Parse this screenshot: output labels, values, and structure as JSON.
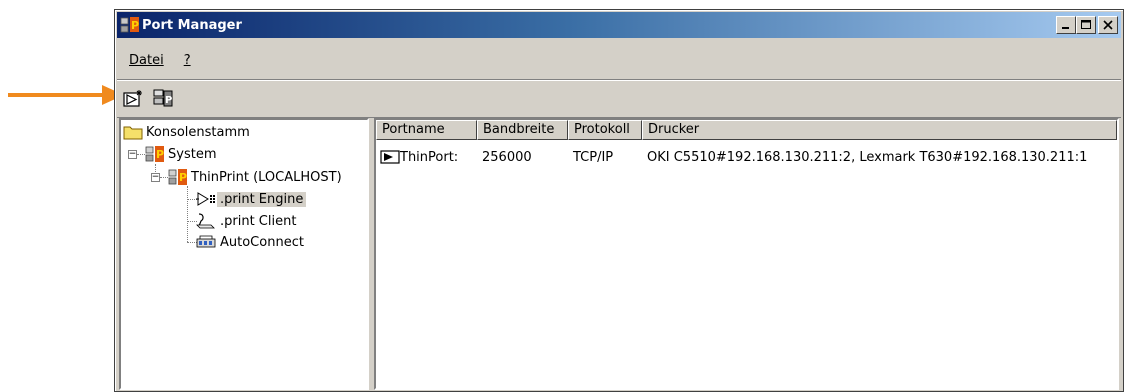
{
  "window": {
    "title": "Port Manager"
  },
  "colors": {
    "annotation_arrow": "#f08a1e",
    "title_bar": "#0a246a"
  },
  "menu": {
    "items": [
      "Datei",
      "?"
    ]
  },
  "toolbar": {
    "buttons": [
      "new-port-icon",
      "port-manager-icon"
    ]
  },
  "tree": {
    "root": "Konsolenstamm",
    "system": "System",
    "host": "ThinPrint (LOCALHOST)",
    "children": [
      ".print Engine",
      ".print Client",
      "AutoConnect"
    ],
    "selected": ".print Engine"
  },
  "list": {
    "columns": [
      "Portname",
      "Bandbreite",
      "Protokoll",
      "Drucker"
    ],
    "rows": [
      {
        "portname": "ThinPort:",
        "bandbreite": "256000",
        "protokoll": "TCP/IP",
        "drucker": "OKI C5510#192.168.130.211:2, Lexmark T630#192.168.130.211:1"
      }
    ]
  }
}
